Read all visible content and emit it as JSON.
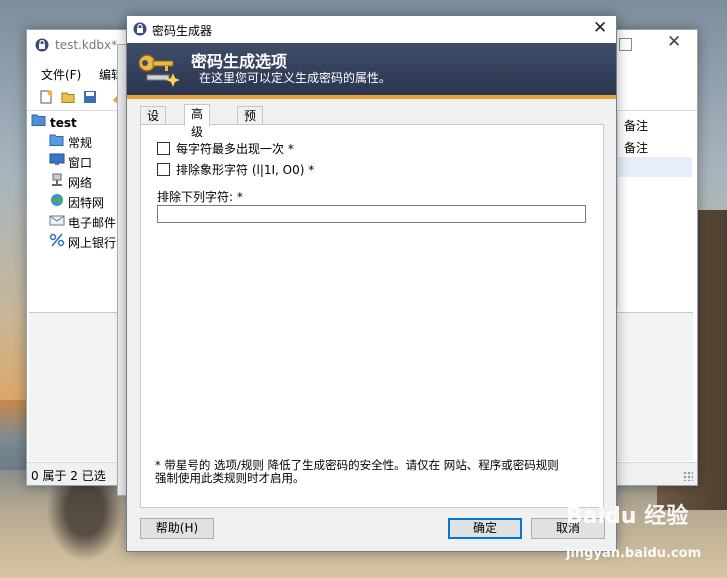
{
  "main_window": {
    "title": "test.kdbx*",
    "menu": [
      "文件(F)",
      "编辑"
    ],
    "tree": [
      {
        "label": "test",
        "icon": "folder-open-icon",
        "bold": true
      },
      {
        "label": "常规",
        "icon": "folder-icon"
      },
      {
        "label": "窗口",
        "icon": "monitor-icon"
      },
      {
        "label": "网络",
        "icon": "network-icon"
      },
      {
        "label": "因特网",
        "icon": "globe-icon"
      },
      {
        "label": "电子邮件",
        "icon": "email-icon"
      },
      {
        "label": "网上银行",
        "icon": "percent-icon"
      }
    ],
    "entries_column": [
      "备注",
      "备注"
    ],
    "status": "0 属于 2 已选"
  },
  "dialog": {
    "title": "密码生成器",
    "header_title": "密码生成选项",
    "header_subtitle": "在这里您可以定义生成密码的属性。",
    "tabs": [
      {
        "label": "设置",
        "active": false
      },
      {
        "label": "高级",
        "active": true
      },
      {
        "label": "预览",
        "active": false
      }
    ],
    "options": [
      {
        "label": "每字符最多出现一次 *",
        "checked": false
      },
      {
        "label": "排除象形字符 (l|1I, O0) *",
        "checked": false
      }
    ],
    "exclude_label": "排除下列字符: *",
    "exclude_value": "",
    "note_line1": "* 带星号的 选项/规则 降低了生成密码的安全性。请仅在 网站、程序或密码规则",
    "note_line2": "强制使用此类规则时才启用。",
    "help_button": "帮助(H)",
    "ok_button": "确定",
    "cancel_button": "取消"
  },
  "watermark": {
    "logo_text": "Baidu 经验",
    "url": "jingyan.baidu.com"
  },
  "colors": {
    "banner_bg": "#34405a",
    "banner_accent": "#e8a23a",
    "default_button_border": "#0078d7"
  }
}
